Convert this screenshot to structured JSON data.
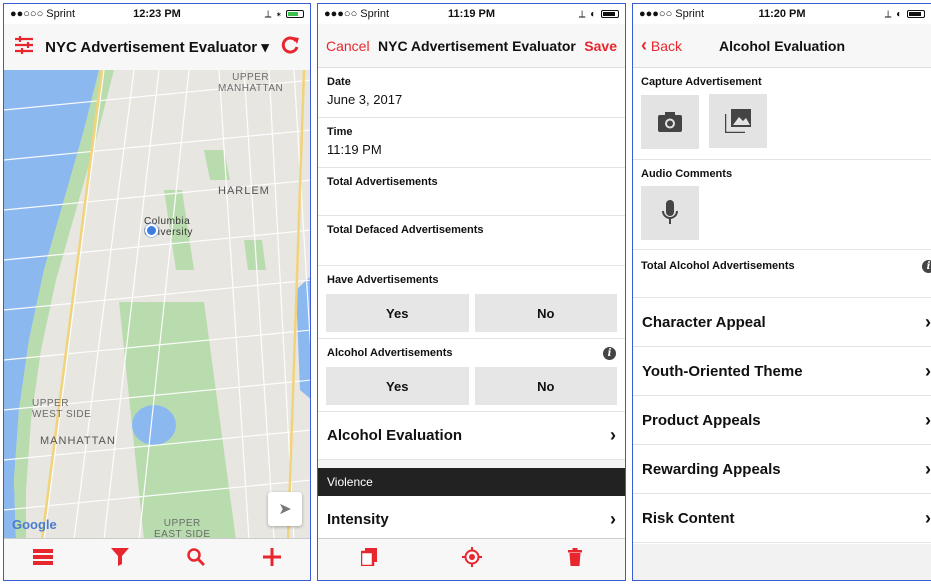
{
  "panel_map": {
    "status": {
      "carrier": "●●○○○ Sprint",
      "time": "12:23 PM",
      "right": "⟂ ∗"
    },
    "nav": {
      "title": "NYC Advertisement Evaluator ▾"
    },
    "map_labels": {
      "upper_manhattan": "UPPER\nMANHATTAN",
      "harlem": "HARLEM",
      "columbia": "Columbia\nUniversity",
      "upper_west_side": "UPPER\nWEST SIDE",
      "manhattan": "MANHATTAN",
      "upper_east_side": "UPPER\nEAST SIDE",
      "google": "Google"
    },
    "tabbar": [
      "list-icon",
      "filter-icon",
      "search-icon",
      "add-icon"
    ]
  },
  "panel_form": {
    "status": {
      "carrier": "●●●○○ Sprint",
      "time": "11:19 PM"
    },
    "nav": {
      "cancel": "Cancel",
      "title": "NYC Advertisement Evaluator",
      "save": "Save"
    },
    "fields": {
      "date_label": "Date",
      "date_value": "June 3, 2017",
      "time_label": "Time",
      "time_value": "11:19 PM",
      "total_ads_label": "Total Advertisements",
      "total_defaced_label": "Total Defaced Advertisements",
      "have_ads_label": "Have Advertisements",
      "alcohol_ads_label": "Alcohol Advertisements"
    },
    "buttons": {
      "yes": "Yes",
      "no": "No"
    },
    "alcohol_eval": "Alcohol Evaluation",
    "section_violence": "Violence",
    "intensity": "Intensity",
    "tabbar": [
      "copy-icon",
      "target-icon",
      "trash-icon"
    ]
  },
  "panel_alcohol": {
    "status": {
      "carrier": "●●●○○ Sprint",
      "time": "11:20 PM"
    },
    "nav": {
      "back": "Back",
      "title": "Alcohol Evaluation"
    },
    "capture_label": "Capture Advertisement",
    "audio_label": "Audio Comments",
    "total_alcohol_label": "Total Alcohol Advertisements",
    "rows": [
      "Character Appeal",
      "Youth-Oriented Theme",
      "Product Appeals",
      "Rewarding Appeals",
      "Risk Content"
    ]
  },
  "colors": {
    "accent": "#e8262e",
    "section": "#222222",
    "segment": "#e6e6e6"
  }
}
